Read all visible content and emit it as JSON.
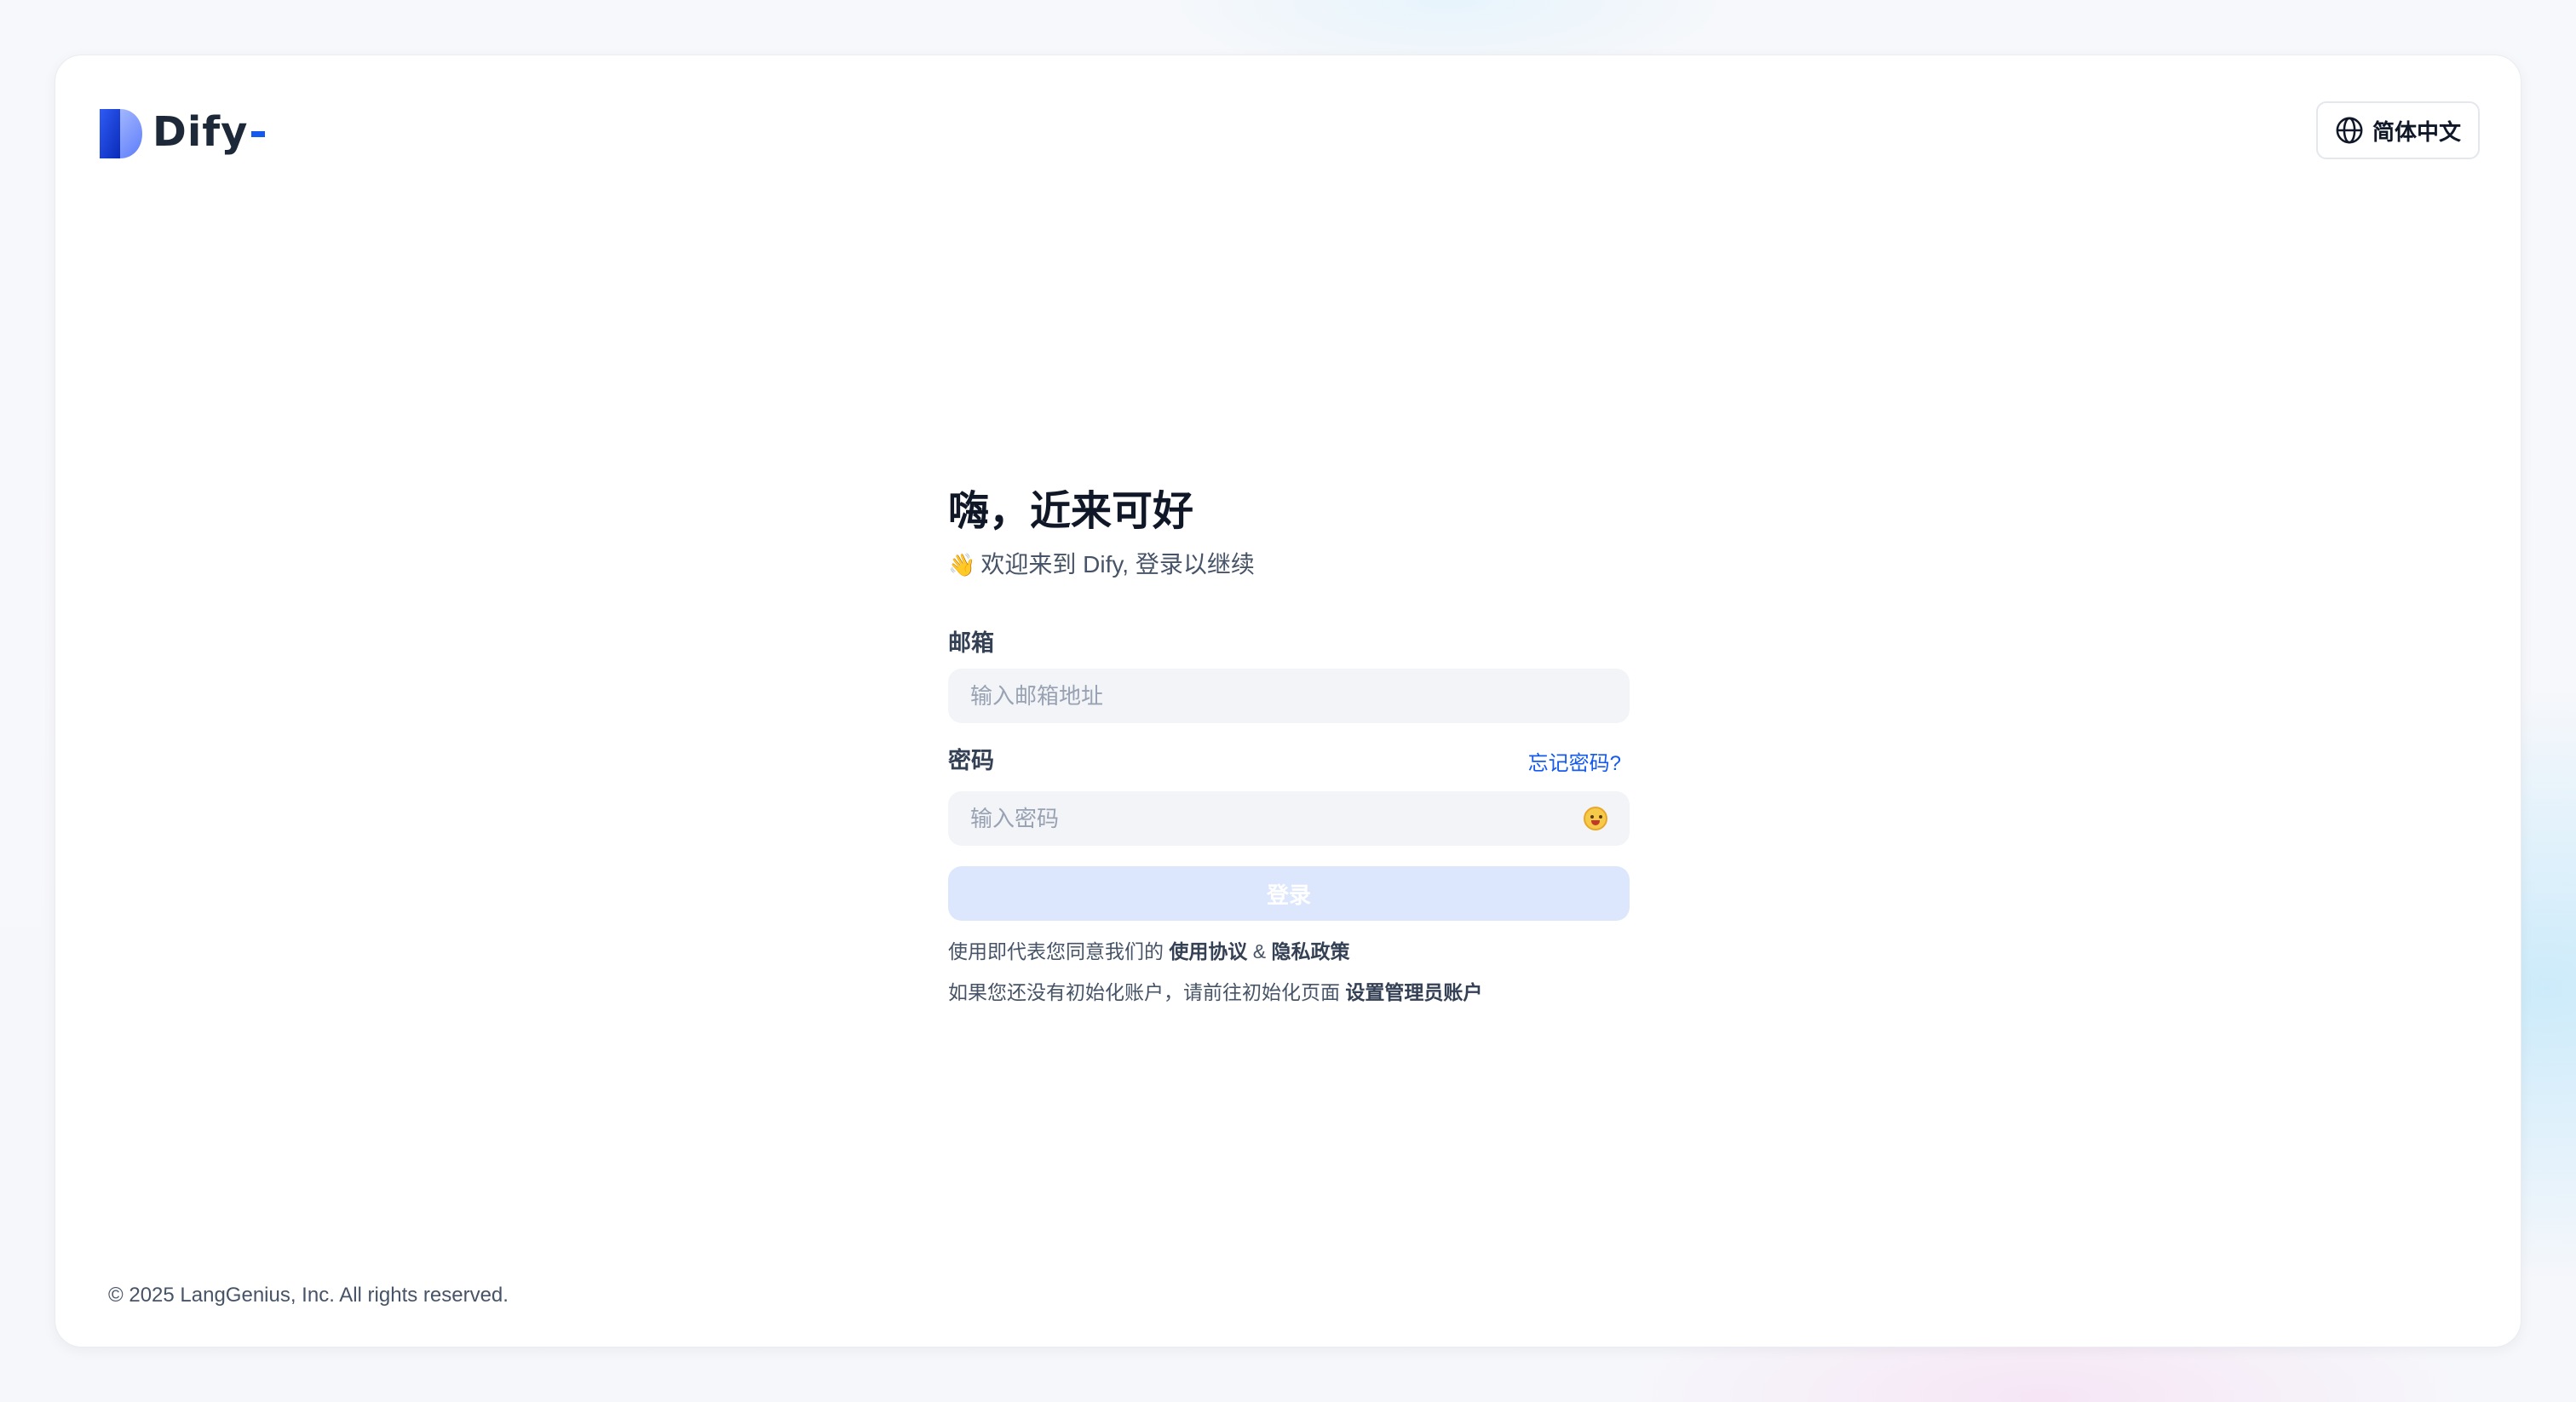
{
  "brand": {
    "name": "Dify",
    "accent": "#155aef"
  },
  "header": {
    "language_label": "简体中文",
    "language_icon": "globe-icon"
  },
  "form": {
    "title": "嗨，近来可好",
    "subtitle_emoji": "👋",
    "subtitle": "欢迎来到 Dify, 登录以继续",
    "email_label": "邮箱",
    "email_placeholder": "输入邮箱地址",
    "email_value": "",
    "password_label": "密码",
    "forgot_password": "忘记密码?",
    "password_placeholder": "输入密码",
    "password_value": "",
    "password_toggle_icon": "emoji-toggle-icon",
    "login_button": "登录",
    "terms_prefix": "使用即代表您同意我们的",
    "terms_link": "使用协议",
    "terms_and": "&",
    "privacy_link": "隐私政策",
    "init_prefix": "如果您还没有初始化账户，请前往初始化页面",
    "init_link": "设置管理员账户"
  },
  "footer": {
    "copyright": "© 2025 LangGenius, Inc. All rights reserved."
  }
}
